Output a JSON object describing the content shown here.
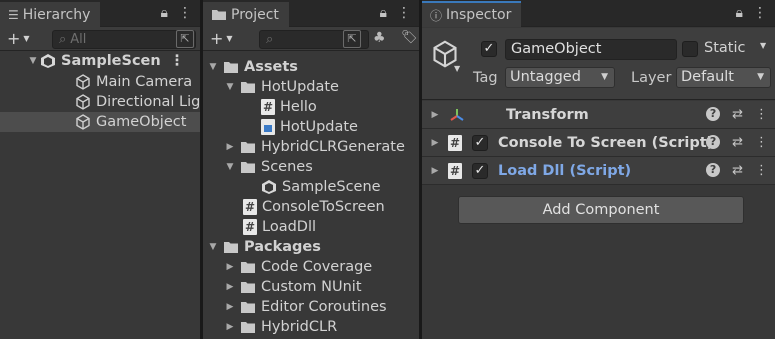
{
  "hierarchy": {
    "tab_title": "Hierarchy",
    "search_placeholder": "All",
    "scene_name": "SampleScen",
    "items": [
      {
        "label": "Main Camera"
      },
      {
        "label": "Directional Lig"
      },
      {
        "label": "GameObject"
      }
    ]
  },
  "project": {
    "tab_title": "Project",
    "search_placeholder": "",
    "tree": {
      "assets_label": "Assets",
      "hotupdate_label": "HotUpdate",
      "hello_label": "Hello",
      "hotupdate_asm_label": "HotUpdate",
      "hybridclrgenerate_label": "HybridCLRGenerate",
      "scenes_label": "Scenes",
      "samplescene_label": "SampleScene",
      "consoletoscreen_label": "ConsoleToScreen",
      "loaddll_label": "LoadDll",
      "packages_label": "Packages",
      "code_coverage_label": "Code Coverage",
      "custom_nunit_label": "Custom NUnit",
      "editor_coroutines_label": "Editor Coroutines",
      "hybridclr_label": "HybridCLR"
    }
  },
  "inspector": {
    "tab_title": "Inspector",
    "object_name": "GameObject",
    "static_label": "Static",
    "tag_label": "Tag",
    "tag_value": "Untagged",
    "layer_label": "Layer",
    "layer_value": "Default",
    "components": [
      {
        "title": "Transform"
      },
      {
        "title": "Console To Screen (Script)"
      },
      {
        "title": "Load Dll (Script)"
      }
    ],
    "add_component_label": "Add Component"
  },
  "colors": {
    "accent": "#3a79bb",
    "link_title": "#7fa8e6",
    "panel_bg": "#383838"
  }
}
